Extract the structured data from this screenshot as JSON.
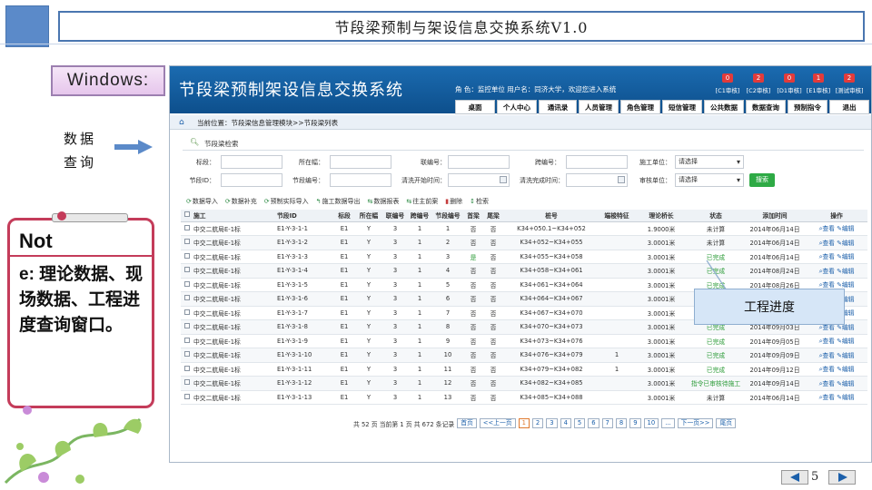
{
  "slide": {
    "title": "节段梁预制与架设信息交换系统V1.0",
    "windows_label": "Windows:",
    "side_caption": [
      "数据",
      "查询"
    ],
    "note_title": "Not",
    "note_text": "e: 理论数据、现场数据、工程进度查询窗口。",
    "callout": "工程进度",
    "page_number": "5"
  },
  "app": {
    "title": "节段梁预制架设信息交换系统",
    "user_info": "角  色：监控单位    用户名：同济大学，欢迎您进入系统",
    "audits": [
      {
        "count": "0",
        "label": "[C1审核]"
      },
      {
        "count": "2",
        "label": "[C2审核]"
      },
      {
        "count": "0",
        "label": "[D1审核]"
      },
      {
        "count": "1",
        "label": "[E1审核]"
      },
      {
        "count": "2",
        "label": "[测试审核]"
      }
    ],
    "nav": [
      "桌面",
      "个人中心",
      "通讯录",
      "人员管理",
      "角色管理",
      "短信管理",
      "公共数据",
      "数据查询",
      "预制指令",
      "退出"
    ],
    "breadcrumb": "当前位置：节段梁信息管理模块>>节段梁列表",
    "panel_title": "节段梁检索",
    "filters": {
      "biaoduan": "标段：",
      "suozaifu": "所在幅：",
      "lianbianhao": "联编号：",
      "kuabianhao": "跨编号：",
      "shigong": "施工单位：",
      "shigong_value": "请选择",
      "jieduanid": "节段ID：",
      "jieduanbianhao": "节段编号：",
      "qingxi_start": "清洗开始时间：",
      "qingxi_end": "清洗完成时间：",
      "shenhe": "审核单位：",
      "shenhe_value": "请选择",
      "search": "搜索"
    },
    "toolbar": [
      "数据导入",
      "数据补充",
      "预制实际导入",
      "施工数据导出",
      "数据报表",
      "往主前案",
      "删除",
      "检索"
    ],
    "columns": [
      "",
      "施工",
      "节段ID",
      "标段",
      "所在幅",
      "联编号",
      "跨编号",
      "节段编号",
      "首梁",
      "尾梁",
      "桩号",
      "端梭特征",
      "理论桥长",
      "状态",
      "添加时间",
      "操作"
    ],
    "rows": [
      [
        "中交二航局E-1标",
        "E1-Y-3-1-1",
        "E1",
        "Y",
        "3",
        "1",
        "1",
        "否",
        "否",
        "K34+050.1~K34+052",
        "",
        "1.9000米",
        "未计算",
        "2014年06月14日"
      ],
      [
        "中交二航局E-1标",
        "E1-Y-3-1-2",
        "E1",
        "Y",
        "3",
        "1",
        "2",
        "否",
        "否",
        "K34+052~K34+055",
        "",
        "3.0001米",
        "未计算",
        "2014年06月14日"
      ],
      [
        "中交二航局E-1标",
        "E1-Y-3-1-3",
        "E1",
        "Y",
        "3",
        "1",
        "3",
        "是",
        "否",
        "K34+055~K34+058",
        "",
        "3.0001米",
        "已完成",
        "2014年06月14日"
      ],
      [
        "中交二航局E-1标",
        "E1-Y-3-1-4",
        "E1",
        "Y",
        "3",
        "1",
        "4",
        "否",
        "否",
        "K34+058~K34+061",
        "",
        "3.0001米",
        "已完成",
        "2014年08月24日"
      ],
      [
        "中交二航局E-1标",
        "E1-Y-3-1-5",
        "E1",
        "Y",
        "3",
        "1",
        "5",
        "否",
        "否",
        "K34+061~K34+064",
        "",
        "3.0001米",
        "已完成",
        "2014年08月26日"
      ],
      [
        "中交二航局E-1标",
        "E1-Y-3-1-6",
        "E1",
        "Y",
        "3",
        "1",
        "6",
        "否",
        "否",
        "K34+064~K34+067",
        "",
        "3.0001米",
        "已完成",
        "2014年08月28日"
      ],
      [
        "中交二航局E-1标",
        "E1-Y-3-1-7",
        "E1",
        "Y",
        "3",
        "1",
        "7",
        "否",
        "否",
        "K34+067~K34+070",
        "",
        "3.0001米",
        "已完成",
        "2014年09月01日"
      ],
      [
        "中交二航局E-1标",
        "E1-Y-3-1-8",
        "E1",
        "Y",
        "3",
        "1",
        "8",
        "否",
        "否",
        "K34+070~K34+073",
        "",
        "3.0001米",
        "已完成",
        "2014年09月03日"
      ],
      [
        "中交二航局E-1标",
        "E1-Y-3-1-9",
        "E1",
        "Y",
        "3",
        "1",
        "9",
        "否",
        "否",
        "K34+073~K34+076",
        "",
        "3.0001米",
        "已完成",
        "2014年09月05日"
      ],
      [
        "中交二航局E-1标",
        "E1-Y-3-1-10",
        "E1",
        "Y",
        "3",
        "1",
        "10",
        "否",
        "否",
        "K34+076~K34+079",
        "1",
        "3.0001米",
        "已完成",
        "2014年09月09日"
      ],
      [
        "中交二航局E-1标",
        "E1-Y-3-1-11",
        "E1",
        "Y",
        "3",
        "1",
        "11",
        "否",
        "否",
        "K34+079~K34+082",
        "1",
        "3.0001米",
        "已完成",
        "2014年09月12日"
      ],
      [
        "中交二航局E-1标",
        "E1-Y-3-1-12",
        "E1",
        "Y",
        "3",
        "1",
        "12",
        "否",
        "否",
        "K34+082~K34+085",
        "",
        "3.0001米",
        "指令已审核待施工",
        "2014年09月14日"
      ],
      [
        "中交二航局E-1标",
        "E1-Y-3-1-13",
        "E1",
        "Y",
        "3",
        "1",
        "13",
        "否",
        "否",
        "K34+085~K34+088",
        "",
        "3.0001米",
        "未计算",
        "2014年06月14日"
      ]
    ],
    "ops": {
      "view": "查看",
      "edit": "编辑"
    },
    "pager": {
      "summary": "共 52 页 当前第 1 页 共 672 条记录",
      "first": "首页",
      "prev": "<<上一页",
      "pages": [
        "1",
        "2",
        "3",
        "4",
        "5",
        "6",
        "7",
        "8",
        "9",
        "10",
        "..."
      ],
      "next": "下一页>>",
      "last": "尾页"
    }
  },
  "colors": {
    "header": "#1b6bb0",
    "accent_red": "#c43c5a",
    "ok_green": "#2e9c3a"
  }
}
